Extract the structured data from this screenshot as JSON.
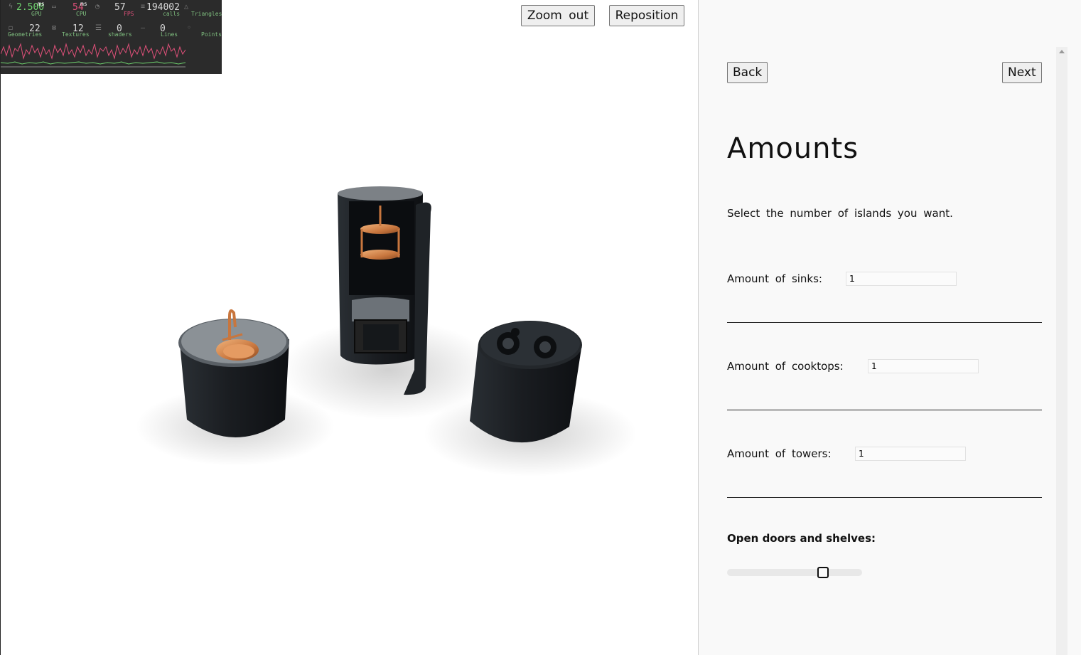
{
  "viewport": {
    "zoom_out_label": "Zoom out",
    "reposition_label": "Reposition",
    "scene_objects": [
      "sink island",
      "tower",
      "cooktop island"
    ]
  },
  "stats": {
    "gpu": {
      "value": "2.500",
      "unit": "ms",
      "label": "GPU"
    },
    "cpu": {
      "value": "54",
      "unit": "ms",
      "label": "CPU"
    },
    "fps": {
      "value": "57",
      "label": "FPS"
    },
    "calls": {
      "value": "194002",
      "label": "calls"
    },
    "triangles": {
      "label": "Triangles"
    },
    "geometries": {
      "value": "22",
      "label": "Geometries"
    },
    "textures": {
      "value": "12",
      "label": "Textures"
    },
    "shaders": {
      "value": "0",
      "label": "shaders"
    },
    "lines": {
      "value": "0",
      "label": "Lines"
    },
    "points": {
      "label": "Points"
    },
    "colors": {
      "background": "#2b2b2b",
      "gpu_line": "#6fd36f",
      "cpu_line": "#e0507a"
    }
  },
  "panel": {
    "back_label": "Back",
    "next_label": "Next",
    "title": "Amounts",
    "description": "Select the number of islands you want.",
    "sinks_label": "Amount of sinks:",
    "sinks_value": "1",
    "cooktops_label": "Amount of cooktops:",
    "cooktops_value": "1",
    "towers_label": "Amount of towers:",
    "towers_value": "1",
    "doors_label": "Open doors and shelves:",
    "doors_slider_fraction": 0.73
  },
  "colors": {
    "panel_bg": "#f9f9f9",
    "viewport_bg": "#ffffff",
    "island_body": "#1c2024",
    "island_top": "#8b9196",
    "copper": "#c8763e"
  }
}
